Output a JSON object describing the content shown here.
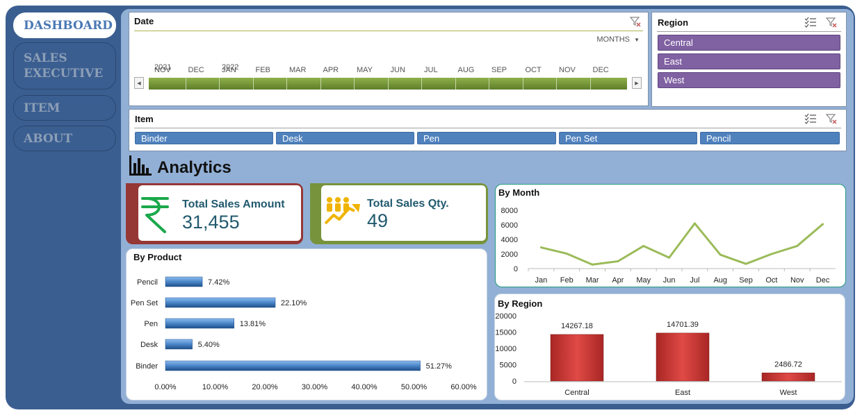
{
  "nav": {
    "dashboard": "DASHBOARD",
    "sales_exec_line1": "SALES",
    "sales_exec_line2": "EXECUTIVE",
    "item": "ITEM",
    "about": "ABOUT"
  },
  "date_slicer": {
    "title": "Date",
    "level": "MONTHS",
    "years": [
      "2021",
      "2022"
    ],
    "months": [
      "NOV",
      "DEC",
      "JAN",
      "FEB",
      "MAR",
      "APR",
      "MAY",
      "JUN",
      "JUL",
      "AUG",
      "SEP",
      "OCT",
      "NOV",
      "DEC"
    ]
  },
  "region_slicer": {
    "title": "Region",
    "items": [
      "Central",
      "East",
      "West"
    ]
  },
  "item_slicer": {
    "title": "Item",
    "items": [
      "Binder",
      "Desk",
      "Pen",
      "Pen Set",
      "Pencil"
    ]
  },
  "analytics": {
    "title": "Analytics"
  },
  "kpi": {
    "sales_amount_label": "Total Sales Amount",
    "sales_amount_value": "31,455",
    "sales_qty_label": "Total Sales Qty.",
    "sales_qty_value": "49"
  },
  "colors": {
    "frame": "#3b5e91",
    "main": "#92b0d6",
    "region_slicer": "#8061a2",
    "item_slicer": "#4f81bd",
    "timeline": "#7a9a3a",
    "month_line": "#9bbb59",
    "product_bar": "#4a86c8",
    "region_bar": "#c8302e",
    "kpi_amount_border": "#953735",
    "kpi_qty_border": "#77933c"
  },
  "chart_data": [
    {
      "type": "line",
      "title": "By Month",
      "x": [
        "Jan",
        "Feb",
        "Mar",
        "Apr",
        "May",
        "Jun",
        "Jul",
        "Aug",
        "Sep",
        "Oct",
        "Nov",
        "Dec"
      ],
      "values": [
        2900,
        2050,
        550,
        1000,
        3100,
        1500,
        6200,
        1900,
        650,
        2000,
        3100,
        6100
      ],
      "ylim": [
        0,
        8000
      ],
      "yticks": [
        "0",
        "2000",
        "4000",
        "6000",
        "8000"
      ]
    },
    {
      "type": "bar",
      "orientation": "horizontal",
      "title": "By Product",
      "categories": [
        "Pencil",
        "Pen Set",
        "Pen",
        "Desk",
        "Binder"
      ],
      "values": [
        7.42,
        22.1,
        13.81,
        5.4,
        51.27
      ],
      "labels": [
        "7.42%",
        "22.10%",
        "13.81%",
        "5.40%",
        "51.27%"
      ],
      "xlim": [
        0,
        60
      ],
      "xticks": [
        "0.00%",
        "10.00%",
        "20.00%",
        "30.00%",
        "40.00%",
        "50.00%",
        "60.00%"
      ]
    },
    {
      "type": "bar",
      "title": "By Region",
      "categories": [
        "Central",
        "East",
        "West"
      ],
      "values": [
        14267.18,
        14701.39,
        2486.72
      ],
      "labels": [
        "14267.18",
        "14701.39",
        "2486.72"
      ],
      "ylim": [
        0,
        20000
      ],
      "yticks": [
        "0",
        "5000",
        "10000",
        "15000",
        "20000"
      ]
    }
  ]
}
